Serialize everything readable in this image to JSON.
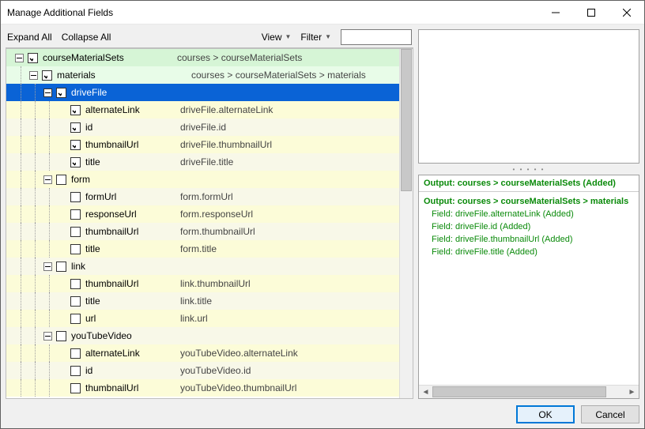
{
  "window": {
    "title": "Manage Additional Fields"
  },
  "toolbar": {
    "expand_all": "Expand All",
    "collapse_all": "Collapse All",
    "view": "View",
    "filter": "Filter",
    "filter_value": ""
  },
  "tree": [
    {
      "level": 0,
      "expand": "minus",
      "checked": true,
      "name": "courseMaterialSets",
      "path": "courses > courseMaterialSets",
      "bg": "bg-green",
      "selected": false
    },
    {
      "level": 1,
      "expand": "minus",
      "checked": true,
      "name": "materials",
      "path": "courses > courseMaterialSets > materials",
      "bg": "bg-lgreen",
      "selected": false
    },
    {
      "level": 2,
      "expand": "minus",
      "checked": true,
      "name": "driveFile",
      "path": "",
      "bg": "bg-blue",
      "selected": true
    },
    {
      "level": 3,
      "expand": "",
      "checked": true,
      "name": "alternateLink",
      "path": "driveFile.alternateLink",
      "bg": "bg-yellow",
      "selected": false
    },
    {
      "level": 3,
      "expand": "",
      "checked": true,
      "name": "id",
      "path": "driveFile.id",
      "bg": "bg-plain",
      "selected": false
    },
    {
      "level": 3,
      "expand": "",
      "checked": true,
      "name": "thumbnailUrl",
      "path": "driveFile.thumbnailUrl",
      "bg": "bg-yellow",
      "selected": false
    },
    {
      "level": 3,
      "expand": "",
      "checked": true,
      "name": "title",
      "path": "driveFile.title",
      "bg": "bg-plain",
      "selected": false
    },
    {
      "level": 2,
      "expand": "minus",
      "checked": false,
      "name": "form",
      "path": "",
      "bg": "bg-yellow",
      "selected": false
    },
    {
      "level": 3,
      "expand": "",
      "checked": false,
      "name": "formUrl",
      "path": "form.formUrl",
      "bg": "bg-plain",
      "selected": false
    },
    {
      "level": 3,
      "expand": "",
      "checked": false,
      "name": "responseUrl",
      "path": "form.responseUrl",
      "bg": "bg-yellow",
      "selected": false
    },
    {
      "level": 3,
      "expand": "",
      "checked": false,
      "name": "thumbnailUrl",
      "path": "form.thumbnailUrl",
      "bg": "bg-plain",
      "selected": false
    },
    {
      "level": 3,
      "expand": "",
      "checked": false,
      "name": "title",
      "path": "form.title",
      "bg": "bg-yellow",
      "selected": false
    },
    {
      "level": 2,
      "expand": "minus",
      "checked": false,
      "name": "link",
      "path": "",
      "bg": "bg-plain",
      "selected": false
    },
    {
      "level": 3,
      "expand": "",
      "checked": false,
      "name": "thumbnailUrl",
      "path": "link.thumbnailUrl",
      "bg": "bg-yellow",
      "selected": false
    },
    {
      "level": 3,
      "expand": "",
      "checked": false,
      "name": "title",
      "path": "link.title",
      "bg": "bg-plain",
      "selected": false
    },
    {
      "level": 3,
      "expand": "",
      "checked": false,
      "name": "url",
      "path": "link.url",
      "bg": "bg-yellow",
      "selected": false
    },
    {
      "level": 2,
      "expand": "minus",
      "checked": false,
      "name": "youTubeVideo",
      "path": "",
      "bg": "bg-plain",
      "selected": false
    },
    {
      "level": 3,
      "expand": "",
      "checked": false,
      "name": "alternateLink",
      "path": "youTubeVideo.alternateLink",
      "bg": "bg-yellow",
      "selected": false
    },
    {
      "level": 3,
      "expand": "",
      "checked": false,
      "name": "id",
      "path": "youTubeVideo.id",
      "bg": "bg-plain",
      "selected": false
    },
    {
      "level": 3,
      "expand": "",
      "checked": false,
      "name": "thumbnailUrl",
      "path": "youTubeVideo.thumbnailUrl",
      "bg": "bg-yellow",
      "selected": false
    }
  ],
  "output": {
    "group1_head": "Output: courses > courseMaterialSets (Added)",
    "group2_head": "Output: courses > courseMaterialSets > materials",
    "fields": [
      "Field: driveFile.alternateLink (Added)",
      "Field: driveFile.id (Added)",
      "Field: driveFile.thumbnailUrl (Added)",
      "Field: driveFile.title (Added)"
    ]
  },
  "buttons": {
    "ok": "OK",
    "cancel": "Cancel"
  }
}
